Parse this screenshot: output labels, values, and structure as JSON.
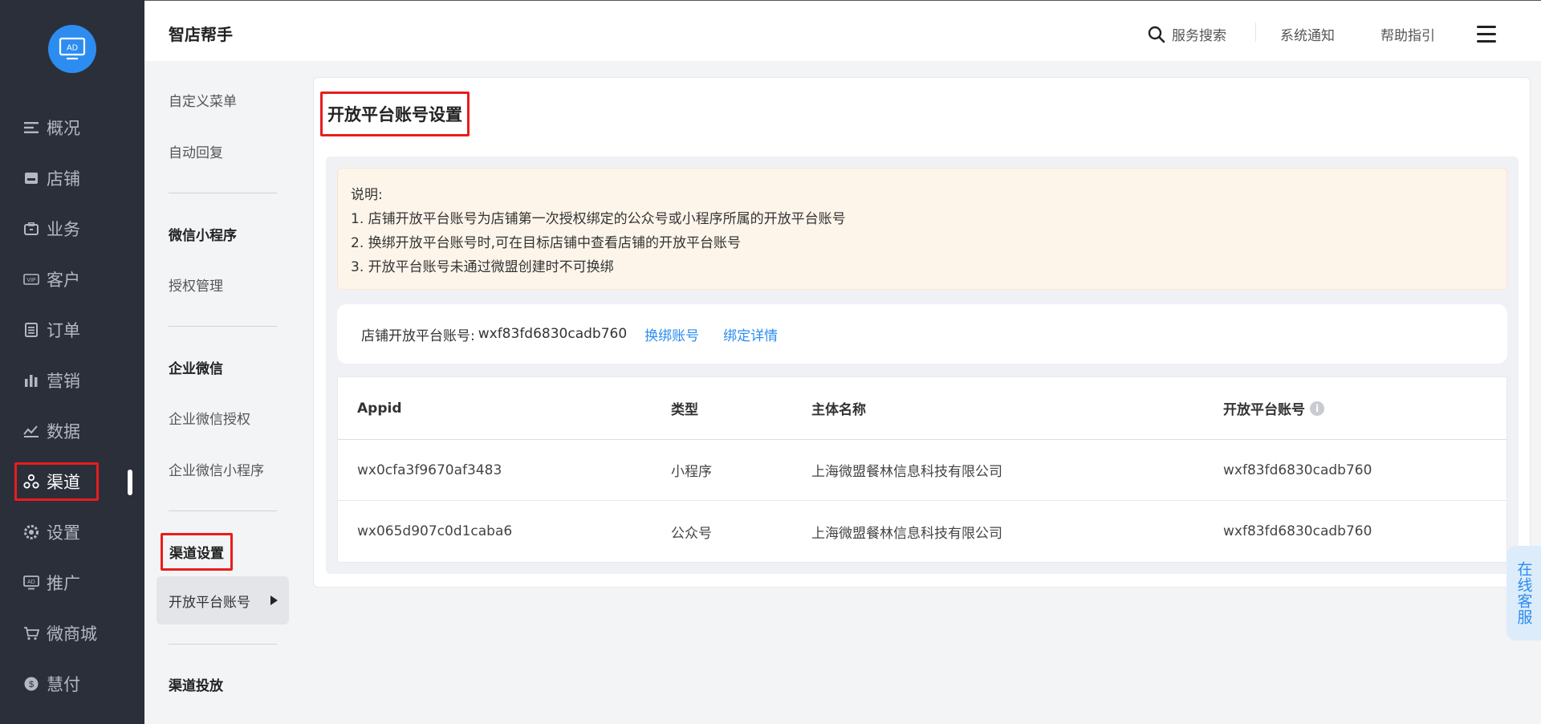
{
  "app": {
    "title": "智店帮手"
  },
  "header": {
    "search_label": "服务搜索",
    "notify_label": "系统通知",
    "help_label": "帮助指引"
  },
  "logo": {
    "text": "AD"
  },
  "leftnav": {
    "items": [
      {
        "label": "概况",
        "icon": "overview-icon"
      },
      {
        "label": "店铺",
        "icon": "store-icon"
      },
      {
        "label": "业务",
        "icon": "business-icon"
      },
      {
        "label": "客户",
        "icon": "vip-customer-icon"
      },
      {
        "label": "订单",
        "icon": "order-icon"
      },
      {
        "label": "营销",
        "icon": "marketing-icon"
      },
      {
        "label": "数据",
        "icon": "data-icon"
      },
      {
        "label": "渠道",
        "icon": "channel-icon",
        "active": true
      },
      {
        "label": "设置",
        "icon": "settings-icon"
      },
      {
        "label": "推广",
        "icon": "promotion-icon"
      },
      {
        "label": "微商城",
        "icon": "mall-icon"
      },
      {
        "label": "慧付",
        "icon": "pay-icon"
      }
    ]
  },
  "submenu": {
    "custom_menu": "自定义菜单",
    "auto_reply": "自动回复",
    "miniprogram_head": "微信小程序",
    "auth_manage": "授权管理",
    "wework_head": "企业微信",
    "wework_auth": "企业微信授权",
    "wework_mini": "企业微信小程序",
    "channel_setting_head": "渠道设置",
    "open_platform": "开放平台账号",
    "channel_delivery_head": "渠道投放"
  },
  "main": {
    "title": "开放平台账号设置",
    "notice": {
      "heading": "说明:",
      "lines": [
        "1. 店铺开放平台账号为店铺第一次授权绑定的公众号或小程序所属的开放平台账号",
        "2. 换绑开放平台账号时,可在目标店铺中查看店铺的开放平台账号",
        "3. 开放平台账号未通过微盟创建时不可换绑"
      ]
    },
    "account": {
      "label": "店铺开放平台账号:",
      "value": "wxf83fd6830cadb760",
      "rebind": "换绑账号",
      "detail": "绑定详情"
    },
    "table": {
      "headers": [
        "Appid",
        "类型",
        "主体名称",
        "开放平台账号"
      ],
      "rows": [
        [
          "wx0cfa3f9670af3483",
          "小程序",
          "上海微盟餐林信息科技有限公司",
          "wxf83fd6830cadb760"
        ],
        [
          "wx065d907c0d1caba6",
          "公众号",
          "上海微盟餐林信息科技有限公司",
          "wxf83fd6830cadb760"
        ]
      ]
    }
  },
  "online_service": {
    "label": "在线客服"
  },
  "colors": {
    "nav_bg": "#2b2f3a",
    "accent": "#2d8cf0",
    "highlight": "#e81d1d",
    "notice_bg": "#fef5ea"
  }
}
